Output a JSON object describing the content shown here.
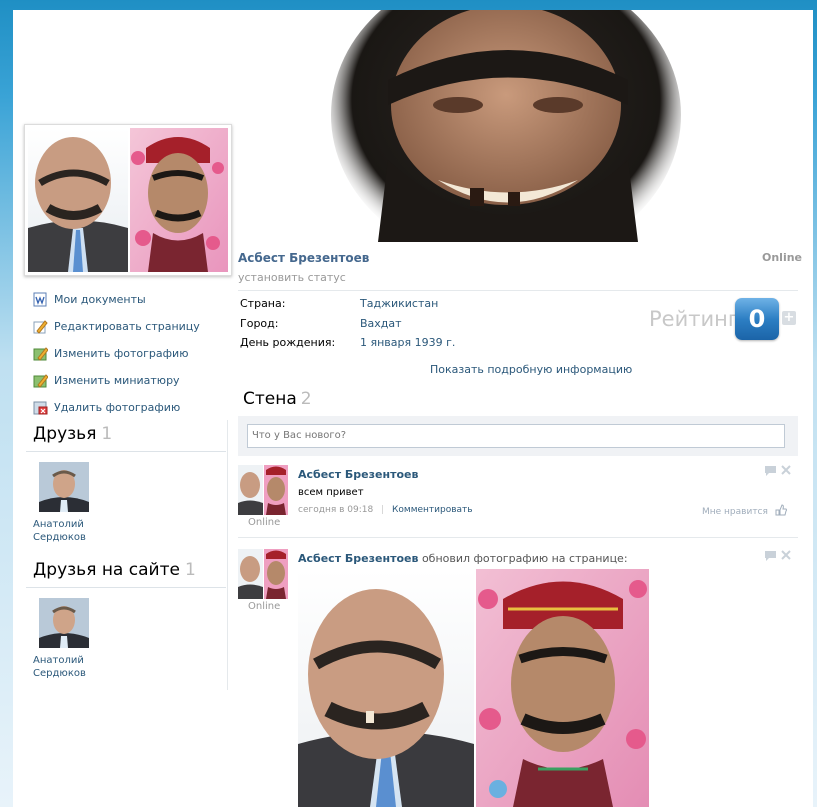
{
  "profile": {
    "name": "Асбест Брезентоев",
    "status_placeholder": "установить статус",
    "online": "Online"
  },
  "menu": [
    {
      "label": "Мои документы",
      "icon": "documents-icon"
    },
    {
      "label": "Редактировать страницу",
      "icon": "edit-page-icon"
    },
    {
      "label": "Изменить фотографию",
      "icon": "change-photo-icon"
    },
    {
      "label": "Изменить миниатюру",
      "icon": "change-thumbnail-icon"
    },
    {
      "label": "Удалить фотографию",
      "icon": "delete-photo-icon"
    }
  ],
  "friends": {
    "title": "Друзья",
    "count": "1",
    "items": [
      {
        "name_line1": "Анатолий",
        "name_line2": "Сердюков"
      }
    ]
  },
  "friends_online": {
    "title": "Друзья на сайте",
    "count": "1",
    "items": [
      {
        "name_line1": "Анатолий",
        "name_line2": "Сердюков"
      }
    ]
  },
  "info": {
    "country_label": "Страна:",
    "country_value": "Таджикистан",
    "city_label": "Город:",
    "city_value": "Вахдат",
    "birthday_label": "День рождения:",
    "birthday_value": "1 января 1939 г.",
    "more_link": "Показать подробную информацию"
  },
  "rating": {
    "label": "Рейтинг",
    "value": "0",
    "plus": "+"
  },
  "wall": {
    "title": "Стена",
    "count": "2",
    "input_placeholder": "Что у Вас нового?",
    "posts": [
      {
        "author": "Асбест Брезентоев",
        "text": "всем привет",
        "time": "сегодня в 09:18",
        "separator": "|",
        "comment_link": "Комментировать",
        "like_text": "Мне нравится",
        "online": "Online"
      },
      {
        "author": "Асбест Брезентоев",
        "action": "обновил фотографию на странице:",
        "online": "Online"
      }
    ]
  },
  "colors": {
    "link": "#2b587a",
    "name": "#45688e",
    "rating_badge": "#2d7fc4",
    "muted": "#999999"
  }
}
